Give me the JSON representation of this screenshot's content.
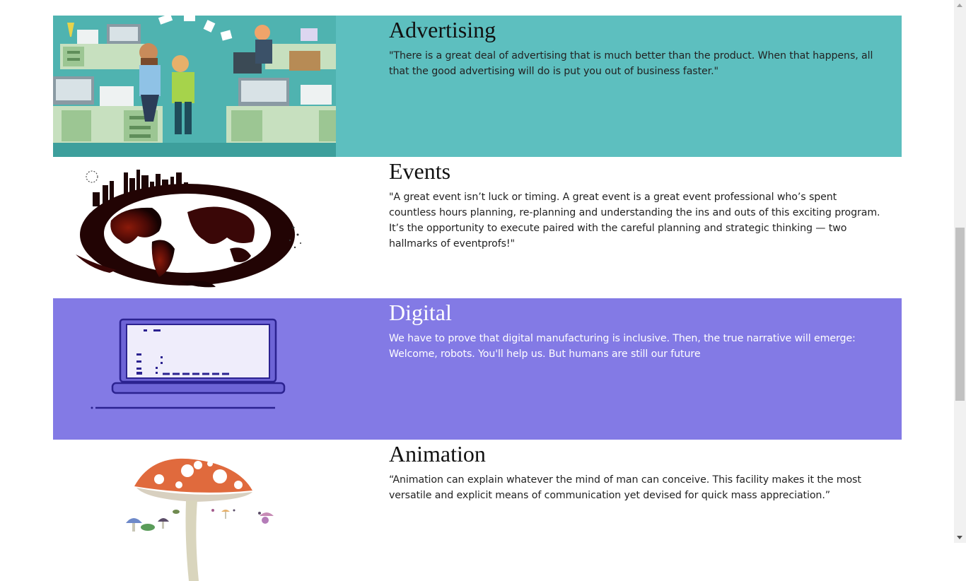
{
  "sections": [
    {
      "title": "Advertising",
      "quote": "\"There is a great deal of advertising that is much better than the product. When that happens, all that the good advertising will do is put you out of business faster.\"",
      "background": "#5dbfbf",
      "image_icon": "office-workers-illustration"
    },
    {
      "title": "Events",
      "quote": "\"A great event isn’t luck or timing. A great event is a great event professional who’s spent countless hours planning, re-planning and understanding the ins and outs of this exciting program. It’s the opportunity to execute paired with the careful planning and strategic thinking — two hallmarks of eventprofs!\"",
      "background": "#ffffff",
      "image_icon": "city-globe-illustration"
    },
    {
      "title": "Digital",
      "quote": "We have to prove that digital manufacturing is inclusive. Then, the true narrative will emerge: Welcome, robots. You'll help us. But humans are still our future",
      "background": "#837ae5",
      "image_icon": "laptop-illustration"
    },
    {
      "title": "Animation",
      "quote": "“Animation can explain whatever the mind of man can conceive. This facility makes it the most versatile and explicit means of communication yet devised for quick mass appreciation.”",
      "background": "#ffffff",
      "image_icon": "mushroom-illustration"
    }
  ]
}
